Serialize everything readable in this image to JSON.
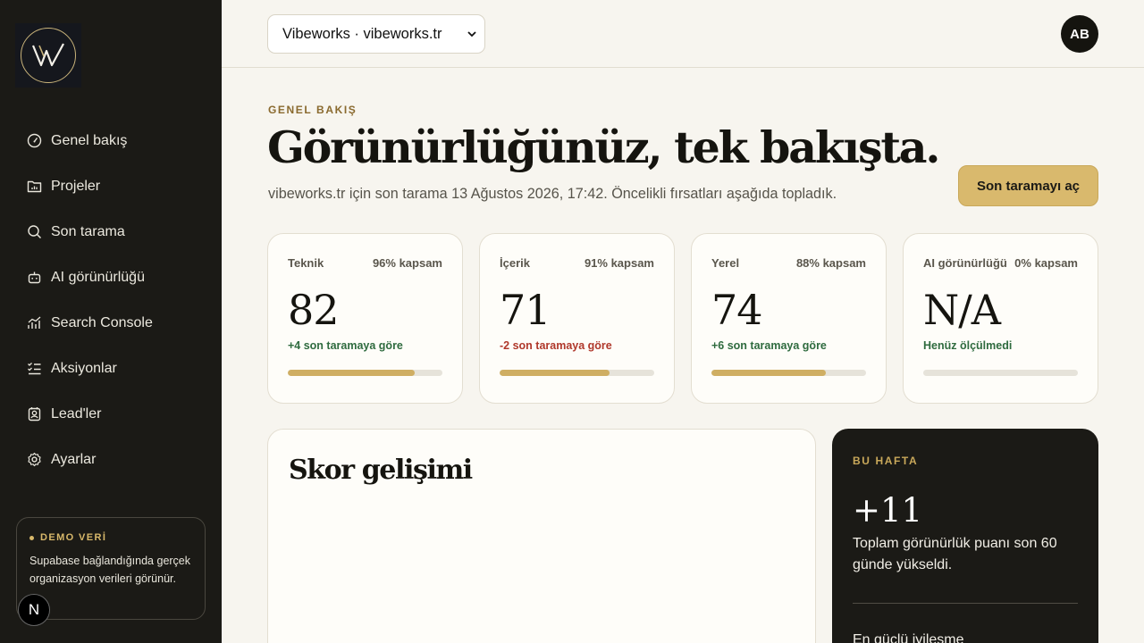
{
  "sidebar": {
    "nav": [
      {
        "label": "Genel bakış",
        "icon": "gauge-icon"
      },
      {
        "label": "Projeler",
        "icon": "folder-chart-icon"
      },
      {
        "label": "Son tarama",
        "icon": "search-icon"
      },
      {
        "label": "AI görünürlüğü",
        "icon": "bot-icon"
      },
      {
        "label": "Search Console",
        "icon": "trend-chart-icon"
      },
      {
        "label": "Aksiyonlar",
        "icon": "list-checks-icon"
      },
      {
        "label": "Lead'ler",
        "icon": "contact-icon"
      },
      {
        "label": "Ayarlar",
        "icon": "gear-icon"
      }
    ],
    "demo": {
      "title": "DEMO VERİ",
      "text": "Supabase bağlandığında gerçek organizasyon verileri görünür."
    },
    "badge": "N"
  },
  "topbar": {
    "project_select": "Vibeworks · vibeworks.tr",
    "avatar": "AB"
  },
  "header": {
    "eyebrow": "GENEL BAKIŞ",
    "title": "Görünürlüğünüz, tek bakışta.",
    "subtitle": "vibeworks.tr için son tarama 13 Ağustos 2026, 17:42. Öncelikli fırsatları aşağıda topladık.",
    "cta": "Son taramayı aç"
  },
  "cards": [
    {
      "label": "Teknik",
      "coverage": "96% kapsam",
      "score": "82",
      "delta": "+4 son taramaya göre",
      "delta_color": "#2f6b3f",
      "progress": 0.82
    },
    {
      "label": "İçerik",
      "coverage": "91% kapsam",
      "score": "71",
      "delta": "-2 son taramaya göre",
      "delta_color": "#b0382b",
      "progress": 0.71
    },
    {
      "label": "Yerel",
      "coverage": "88% kapsam",
      "score": "74",
      "delta": "+6 son taramaya göre",
      "delta_color": "#2f6b3f",
      "progress": 0.74
    },
    {
      "label": "AI görünürlüğü",
      "coverage": "0% kapsam",
      "score": "N/A",
      "delta": "Henüz ölçülmedi",
      "delta_color": "#2f6b3f",
      "progress": 0
    }
  ],
  "chart": {
    "title": "Skor gelişimi"
  },
  "week": {
    "eyebrow": "BU HAFTA",
    "value": "+11",
    "text": "Toplam görünürlük puanı son 60 günde yükseldi.",
    "next": "En güçlü iyileşme"
  },
  "colors": {
    "sidebar_bg": "#1b1a16",
    "accent": "#d9b96d",
    "page_bg": "#f7f5ef"
  }
}
